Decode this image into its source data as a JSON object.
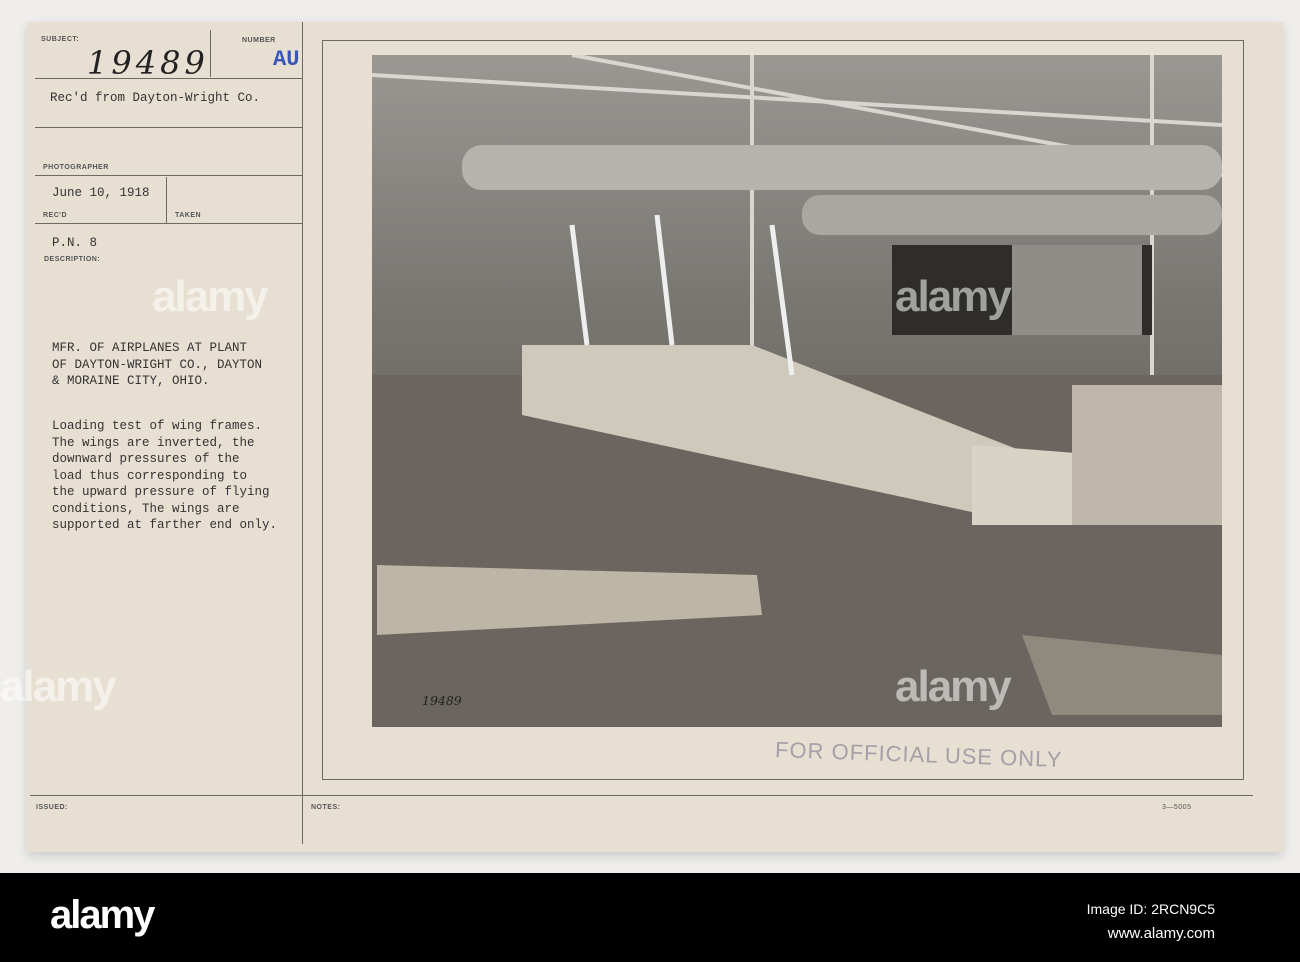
{
  "card": {
    "subject_label": "SUBJECT:",
    "number_label": "NUMBER",
    "subject_number": "19489",
    "number_code": "AU",
    "received_from": "Rec'd from Dayton-Wright Co.",
    "photographer_label": "PHOTOGRAPHER",
    "date": "June 10, 1918",
    "recd_label": "REC'D",
    "taken_label": "TAKEN",
    "pn": "P.N. 8",
    "description_label": "DESCRIPTION:",
    "title_lines": [
      "MFR. OF AIRPLANES AT PLANT",
      "OF DAYTON-WRIGHT CO., DAYTON",
      "& MORAINE CITY, OHIO."
    ],
    "description_lines": [
      "Loading test of wing frames.",
      "The wings are inverted, the",
      "downward pressures of the",
      "load thus corresponding to",
      "the upward pressure of flying",
      "conditions, The wings are",
      "supported at farther end only."
    ],
    "photo_number": "19489",
    "stamp": "FOR OFFICIAL USE ONLY",
    "issued_label": "ISSUED:",
    "notes_label": "NOTES:",
    "form_code": "3—5005"
  },
  "watermark": "alamy",
  "footer": {
    "logo": "alamy",
    "image_id": "Image ID: 2RCN9C5",
    "url": "www.alamy.com"
  }
}
